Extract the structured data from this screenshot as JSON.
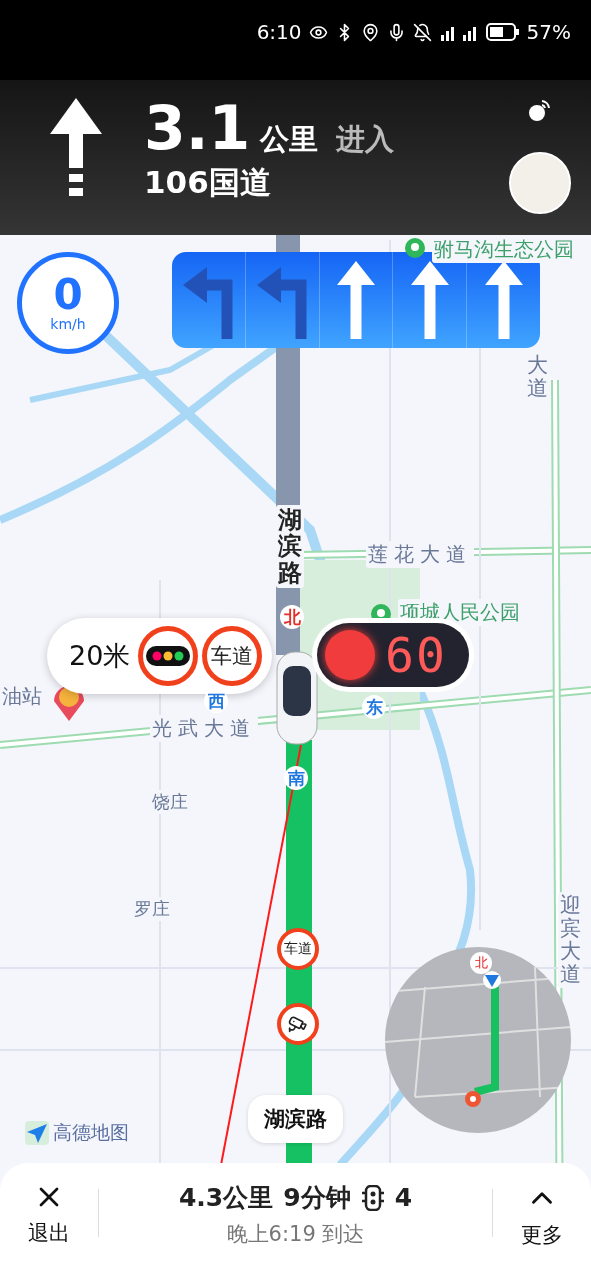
{
  "status_bar": {
    "time": "6:10",
    "battery": "57%"
  },
  "guidance": {
    "distance": "3.1",
    "unit": "公里",
    "action": "进入",
    "road": "106国道"
  },
  "lanes": [
    {
      "kind": "left",
      "selected": false
    },
    {
      "kind": "left",
      "selected": false
    },
    {
      "kind": "straight",
      "selected": true
    },
    {
      "kind": "straight",
      "selected": true
    },
    {
      "kind": "straight",
      "selected": true
    }
  ],
  "speed": {
    "value": "0",
    "unit": "km/h"
  },
  "map_labels": [
    {
      "text": "驸马沟生态公园",
      "kind": "park"
    },
    {
      "text": "大道",
      "kind": "road_vertical"
    },
    {
      "text": "湖滨路",
      "kind": "main_vertical"
    },
    {
      "text": "莲花大道",
      "kind": "road"
    },
    {
      "text": "项城人民公园",
      "kind": "park"
    },
    {
      "text": "光武大道",
      "kind": "road"
    },
    {
      "text": "油站",
      "kind": "place"
    },
    {
      "text": "饶庄",
      "kind": "place"
    },
    {
      "text": "罗庄",
      "kind": "place"
    },
    {
      "text": "迎宾大道",
      "kind": "road_vertical"
    }
  ],
  "compass": [
    {
      "text": "北",
      "kind": "north"
    },
    {
      "text": "西",
      "kind": "other"
    },
    {
      "text": "东",
      "kind": "other"
    },
    {
      "text": "南",
      "kind": "other"
    }
  ],
  "alert": {
    "distance": "20米",
    "lane_label": "车道"
  },
  "traffic_light": {
    "countdown": "60"
  },
  "route_markers": [
    {
      "kind": "lane",
      "label": "车道"
    },
    {
      "kind": "camera"
    }
  ],
  "road_pill": "湖滨路",
  "logo": "高德地图",
  "minimap": {
    "north": "北"
  },
  "trip": {
    "distance": "4.3公里",
    "time": "9分钟",
    "lights": "4",
    "arrival": "晚上6:19 到达"
  },
  "buttons": {
    "exit": "退出",
    "more": "更多"
  }
}
